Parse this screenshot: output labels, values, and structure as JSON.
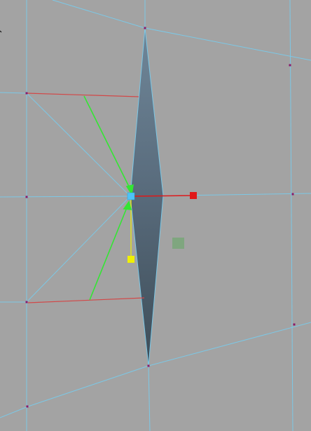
{
  "viewport": {
    "kind": "3d-mesh-edit-viewport",
    "mode": "vertex-edit",
    "background_color": "#a3a3a3"
  },
  "colors": {
    "wireframe_edge": "#7cc8e6",
    "vertex": "#8a1a6a",
    "selected_face_top": "#6f8698",
    "selected_face_bottom": "#3e4d58",
    "tangent_handle": "#d24848",
    "normal_arrow": "#33e633",
    "gizmo_x_axis": "#e01818",
    "gizmo_y_axis": "#f0f000",
    "gizmo_z_axis": "#55aa55",
    "pivot": "#4fc3f7"
  },
  "gizmo": {
    "axes": [
      "x",
      "y",
      "z"
    ],
    "x_handle_icon": "square-handle-icon",
    "y_handle_icon": "square-handle-icon",
    "z_handle_icon": "translucent-square-icon"
  },
  "selection": {
    "element": "face",
    "shape": "diamond"
  }
}
